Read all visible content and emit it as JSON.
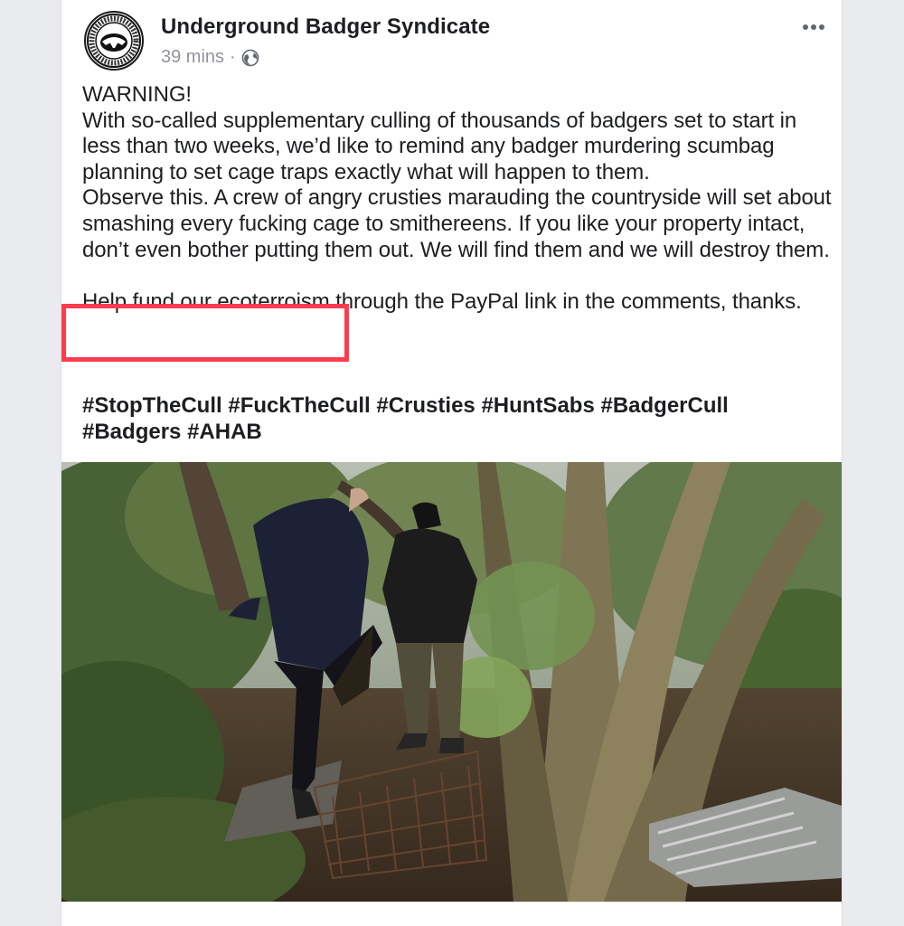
{
  "post": {
    "page_name": "Underground Badger Syndicate",
    "time": "39 mins",
    "separator": "·",
    "privacy_icon": "globe-icon",
    "more_icon": "more-horizontal-icon",
    "paragraphs": [
      "WARNING!",
      "With so-called supplementary culling of thousands of badgers set to start in less than two weeks, we’d like to remind any badger murdering scumbag planning to set cage traps exactly what will happen to them.",
      "Observe this. A crew of angry crusties marauding the countryside will set about smashing every fucking cage to smithereens. If you like your property intact, don’t even bother putting them out. We will find them and we will destroy them.",
      "Help fund our ecoterroism through the PayPal link in the comments, thanks."
    ],
    "hashtags": [
      "#StopTheCull",
      "#FuckTheCull",
      "#Crusties",
      "#HuntSabs",
      "#BadgerCull",
      "#Badgers",
      "#AHAB"
    ],
    "photo_icon": "post-photo"
  },
  "colors": {
    "highlight": "#ff3b4f",
    "text": "#1c1e21",
    "meta": "#90949c"
  }
}
